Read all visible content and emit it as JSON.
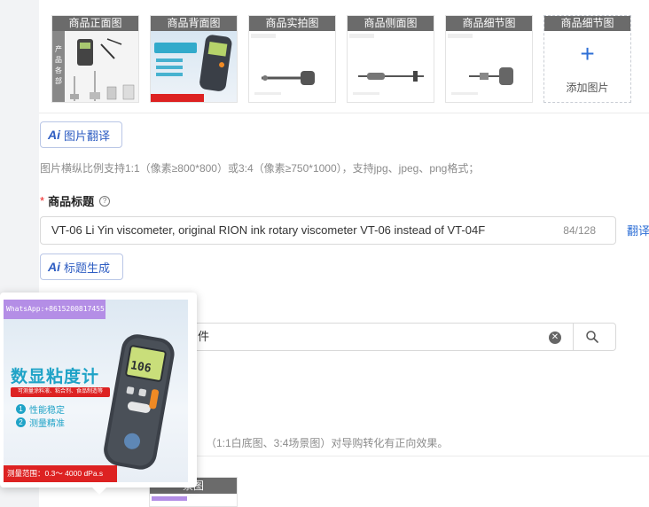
{
  "images": {
    "captions": [
      "商品正面图",
      "商品背面图",
      "商品实拍图",
      "商品侧面图",
      "商品细节图",
      "商品细节图"
    ],
    "add_label": "添加图片"
  },
  "image_translate_button": "图片翻译",
  "image_hint": "图片横纵比例支持1:1（像素≥800*800）或3:4（像素≥750*1000），支持jpg、jpeg、png格式；",
  "title_field": {
    "label": "商品标题",
    "value": "VT-06 Li Yin viscometer, original RION ink rotary viscometer VT-06 instead of VT-04F",
    "counter": "84/128",
    "translate_link": "翻译"
  },
  "title_generate_button": "标题生成",
  "search": {
    "value": "件"
  },
  "main_image_hint": "（1:1白底图、3:4场景图）对导购转化有正向效果。",
  "bottom_thumb_caption": "景图",
  "popup": {
    "whatsapp": "WhatsApp:+8615200817455",
    "heading": "数显粘度计",
    "tagline": "可测量涂料液、粘合剂、食品制造等",
    "features": [
      "性能稳定",
      "测量精准"
    ],
    "feature_numbers": [
      "1",
      "2"
    ],
    "lcd_value": "106",
    "range": "测量范围：0.3～ 4000 dPa.s"
  },
  "colors": {
    "accent": "#2e6fd6",
    "caption_bg": "#6b6b6b",
    "required": "#e22222",
    "popup_brand": "#1fa3c7",
    "popup_red": "#d22222"
  }
}
